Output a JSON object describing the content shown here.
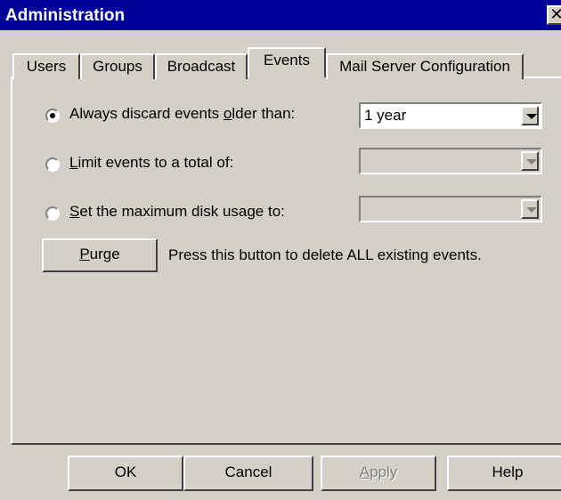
{
  "window": {
    "title": "Administration",
    "close_glyph": "✕"
  },
  "tabs": [
    {
      "label": "Users",
      "active": false
    },
    {
      "label": "Groups",
      "active": false
    },
    {
      "label": "Broadcast",
      "active": false
    },
    {
      "label": "Events",
      "active": true
    },
    {
      "label": "Mail Server Configuration",
      "active": false
    }
  ],
  "events": {
    "options": [
      {
        "pre": "Always discard events ",
        "mnemonic": "o",
        "post": "lder than:",
        "selected": true
      },
      {
        "pre": "",
        "mnemonic": "L",
        "post": "imit events to a total of:",
        "selected": false
      },
      {
        "pre": "",
        "mnemonic": "S",
        "post": "et the maximum disk usage to:",
        "selected": false
      }
    ],
    "combos": [
      {
        "value": "1 year",
        "enabled": true
      },
      {
        "value": "",
        "enabled": false
      },
      {
        "value": "",
        "enabled": false
      }
    ],
    "purge_button": {
      "mnemonic": "P",
      "rest": "urge"
    },
    "purge_description": "Press this button to delete ALL existing events."
  },
  "footer": {
    "ok": "OK",
    "cancel": "Cancel",
    "apply": {
      "mnemonic": "A",
      "rest": "pply",
      "enabled": false
    },
    "help": "Help"
  },
  "colors": {
    "titlebar": "#00009a",
    "face": "#d4d0c8"
  }
}
